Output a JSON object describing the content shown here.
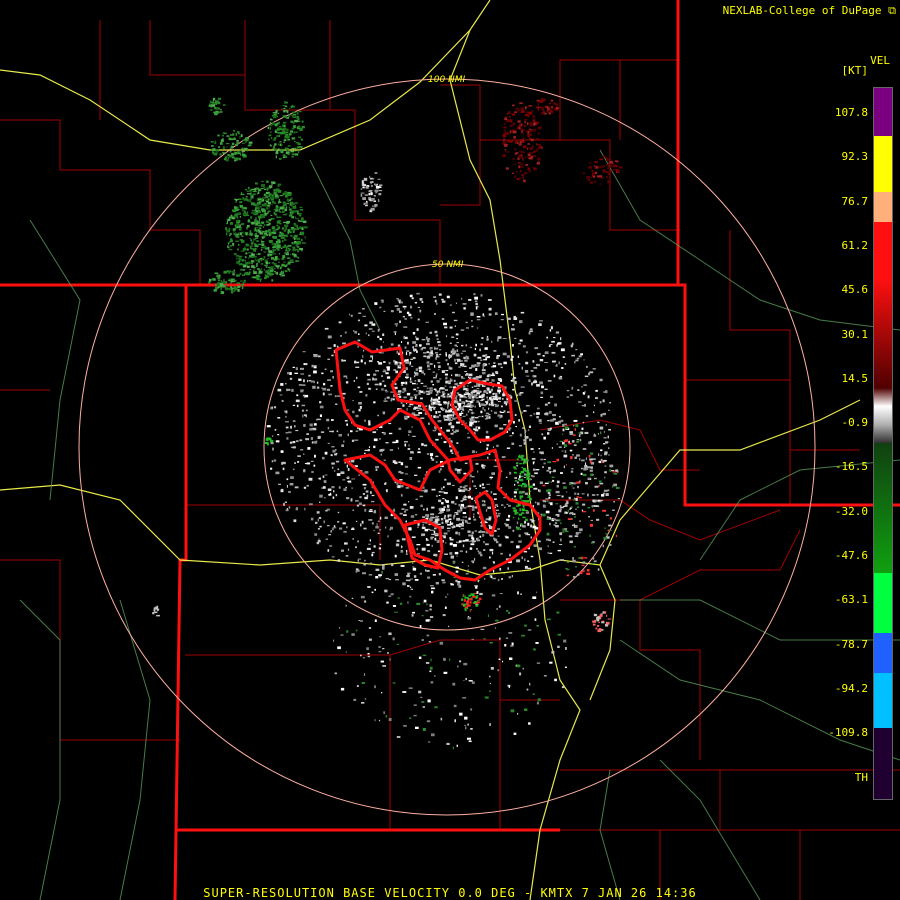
{
  "header": {
    "credit": "NEXLAB-College of DuPage ⧉"
  },
  "legend": {
    "title": "VEL",
    "unit": "[KT]",
    "ticks": [
      "107.8",
      "92.3",
      "76.7",
      "61.2",
      "45.6",
      "30.1",
      "14.5",
      "-0.9",
      "-16.5",
      "-32.0",
      "-47.6",
      "-63.1",
      "-78.7",
      "-94.2",
      "-109.8",
      "TH"
    ],
    "colors": {
      "purple": "#7a0080",
      "yellow": "#ffff00",
      "orange": "#ffb07a",
      "red": "#ff1010",
      "darkred": "#500000",
      "gray": "#b0b0b0",
      "green": "#10a010",
      "brightgreen": "#00ff40",
      "blue": "#2060ff",
      "cyan": "#00c0ff",
      "th": "#200030"
    }
  },
  "range_rings": [
    "100 NMI",
    "50 NMI"
  ],
  "footer": {
    "caption": "SUPER-RESOLUTION BASE VELOCITY 0.0 DEG - KMTX 7 JAN 26 14:36"
  },
  "icons": {
    "external": "external-link-icon"
  }
}
